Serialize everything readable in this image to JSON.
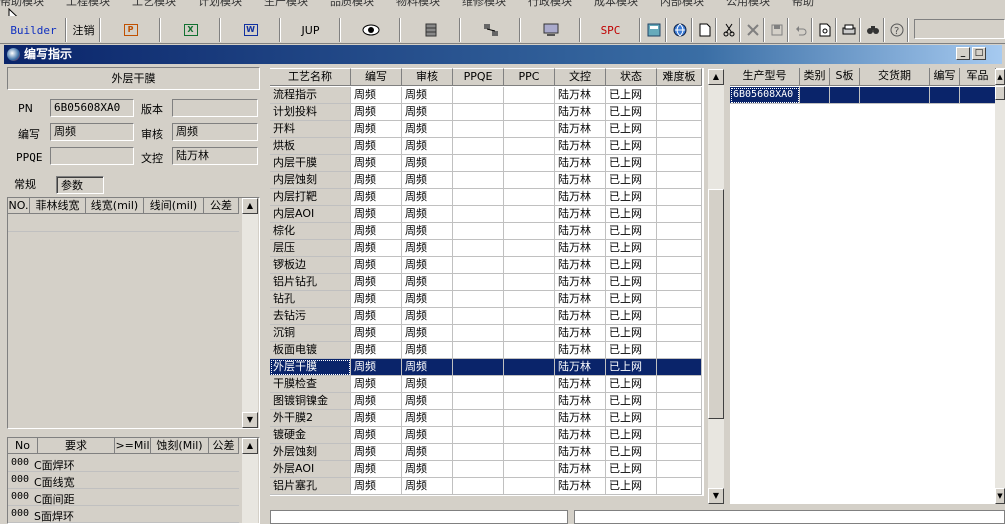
{
  "top_menu": [
    "帮助模块",
    "工程模块",
    "工艺模块",
    "计划模块",
    "生产模块",
    "品质模块",
    "物料模块",
    "维修模块",
    "行政模块",
    "成本模块",
    "内部模块",
    "公用模块",
    "帮助"
  ],
  "toolbar": {
    "builder_label": "Builder",
    "logout_label": "注销",
    "jup_label": "JUP",
    "spc_label": "SPC"
  },
  "window": {
    "title": "编写指示"
  },
  "left": {
    "panel_title": "外层干膜",
    "pn_label": "PN",
    "pn_value": "6B05608XA0",
    "version_label": "版本",
    "version_value": "",
    "writer_label": "编写",
    "writer_value": "周频",
    "reviewer_label": "审核",
    "reviewer_value": "周频",
    "ppqe_label": "PPQE",
    "ppqe_value": "",
    "control_label": "文控",
    "control_value": "陆万林",
    "tabs": [
      "常规",
      "参数"
    ],
    "param_table": {
      "headers": [
        "NO.",
        "菲林线宽",
        "线宽(mil)",
        "线间(mil)",
        "公差"
      ]
    },
    "req_table": {
      "headers": [
        "No",
        "要求",
        ">=Mil",
        "蚀刻(Mil)",
        "公差"
      ],
      "rows": [
        {
          "no": "000",
          "req": "C面焊环"
        },
        {
          "no": "000",
          "req": "C面线宽"
        },
        {
          "no": "000",
          "req": "C面间距"
        },
        {
          "no": "000",
          "req": "S面焊环"
        }
      ]
    }
  },
  "process_grid": {
    "headers": [
      "工艺名称",
      "编写",
      "审核",
      "PPQE",
      "PPC",
      "文控",
      "状态",
      "难度板"
    ],
    "selected_index": 17,
    "rows": [
      {
        "name": "流程指示",
        "writer": "周频",
        "reviewer": "周频",
        "control": "陆万林",
        "status": "已上网"
      },
      {
        "name": "计划投料",
        "writer": "周频",
        "reviewer": "周频",
        "control": "陆万林",
        "status": "已上网"
      },
      {
        "name": "开料",
        "writer": "周频",
        "reviewer": "周频",
        "control": "陆万林",
        "status": "已上网"
      },
      {
        "name": "烘板",
        "writer": "周频",
        "reviewer": "周频",
        "control": "陆万林",
        "status": "已上网"
      },
      {
        "name": "内层干膜",
        "writer": "周频",
        "reviewer": "周频",
        "control": "陆万林",
        "status": "已上网"
      },
      {
        "name": "内层蚀刻",
        "writer": "周频",
        "reviewer": "周频",
        "control": "陆万林",
        "status": "已上网"
      },
      {
        "name": "内层打靶",
        "writer": "周频",
        "reviewer": "周频",
        "control": "陆万林",
        "status": "已上网"
      },
      {
        "name": "内层AOI",
        "writer": "周频",
        "reviewer": "周频",
        "control": "陆万林",
        "status": "已上网"
      },
      {
        "name": "棕化",
        "writer": "周频",
        "reviewer": "周频",
        "control": "陆万林",
        "status": "已上网"
      },
      {
        "name": "层压",
        "writer": "周频",
        "reviewer": "周频",
        "control": "陆万林",
        "status": "已上网"
      },
      {
        "name": "锣板边",
        "writer": "周频",
        "reviewer": "周频",
        "control": "陆万林",
        "status": "已上网"
      },
      {
        "name": "铝片钻孔",
        "writer": "周频",
        "reviewer": "周频",
        "control": "陆万林",
        "status": "已上网"
      },
      {
        "name": "钻孔",
        "writer": "周频",
        "reviewer": "周频",
        "control": "陆万林",
        "status": "已上网"
      },
      {
        "name": "去钻污",
        "writer": "周频",
        "reviewer": "周频",
        "control": "陆万林",
        "status": "已上网"
      },
      {
        "name": "沉铜",
        "writer": "周频",
        "reviewer": "周频",
        "control": "陆万林",
        "status": "已上网"
      },
      {
        "name": "板面电镀",
        "writer": "周频",
        "reviewer": "周频",
        "control": "陆万林",
        "status": "已上网"
      },
      {
        "name": "外层干膜",
        "writer": "周频",
        "reviewer": "周频",
        "control": "陆万林",
        "status": "已上网"
      },
      {
        "name": "干膜检查",
        "writer": "周频",
        "reviewer": "周频",
        "control": "陆万林",
        "status": "已上网"
      },
      {
        "name": "图镀铜镍金",
        "writer": "周频",
        "reviewer": "周频",
        "control": "陆万林",
        "status": "已上网"
      },
      {
        "name": "外干膜2",
        "writer": "周频",
        "reviewer": "周频",
        "control": "陆万林",
        "status": "已上网"
      },
      {
        "name": "镀硬金",
        "writer": "周频",
        "reviewer": "周频",
        "control": "陆万林",
        "status": "已上网"
      },
      {
        "name": "外层蚀刻",
        "writer": "周频",
        "reviewer": "周频",
        "control": "陆万林",
        "status": "已上网"
      },
      {
        "name": "外层AOI",
        "writer": "周频",
        "reviewer": "周频",
        "control": "陆万林",
        "status": "已上网"
      },
      {
        "name": "铝片塞孔",
        "writer": "周频",
        "reviewer": "周频",
        "control": "陆万林",
        "status": "已上网"
      }
    ]
  },
  "right_grid": {
    "headers": [
      "生产型号",
      "类别",
      "S板",
      "交货期",
      "编写",
      "军品"
    ],
    "rows": [
      {
        "model": "6B05608XA0"
      }
    ]
  },
  "colors": {
    "selection": "#0a246a",
    "title_bar": "#0a246a",
    "face": "#d4d0c8"
  }
}
